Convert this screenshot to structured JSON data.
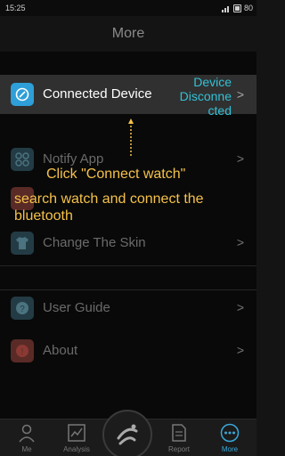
{
  "status_bar": {
    "time": "15:25",
    "battery": "80"
  },
  "header": {
    "title": "More"
  },
  "connected": {
    "label": "Connected Device",
    "status_line1": "Device",
    "status_line2": "Disconne",
    "status_line3": "cted",
    "chevron": ">"
  },
  "menu": {
    "notify_app": "Notify App",
    "change_skin": "Change The Skin",
    "user_guide": "User Guide",
    "about": "About",
    "chevron": ">"
  },
  "hint": {
    "line1": "Click \"Connect watch\"",
    "line2": "search watch and connect the bluetooth"
  },
  "tabs": [
    {
      "label": "Me",
      "icon": "person-icon"
    },
    {
      "label": "Analysis",
      "icon": "analysis-icon"
    },
    {
      "label": "Report",
      "icon": "report-icon"
    },
    {
      "label": "More",
      "icon": "more-icon",
      "active": true
    }
  ],
  "colors": {
    "accent": "#33c1d6",
    "hint": "#f5c24a",
    "device_icon": "#2e9fd8"
  }
}
